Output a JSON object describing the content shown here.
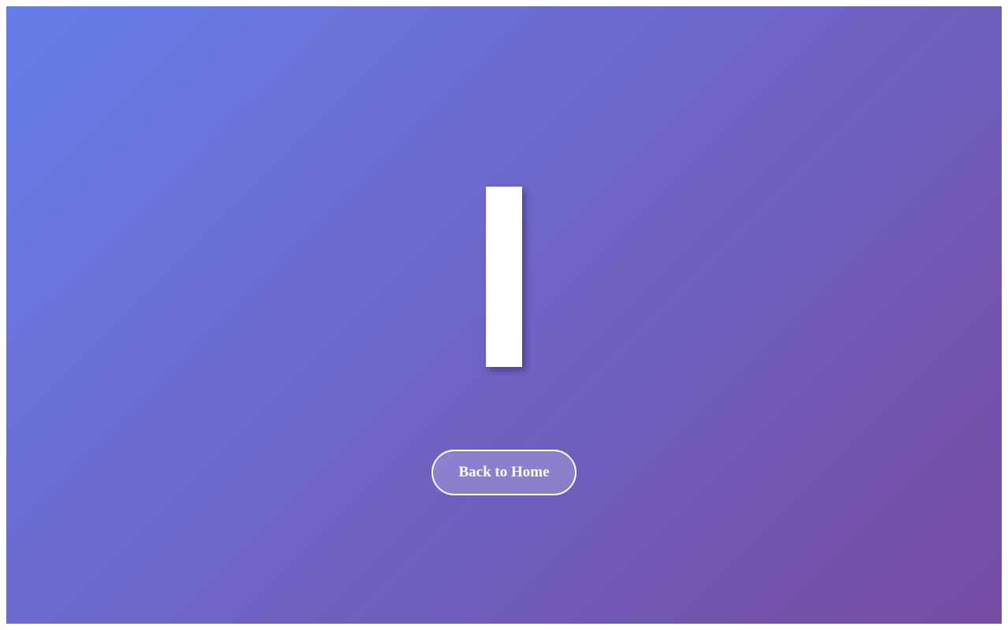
{
  "page": {
    "background_gradient": [
      "#667eea",
      "#764ba2"
    ]
  },
  "hero": {
    "glyph_color": "#ffffff"
  },
  "actions": {
    "back_to_home_label": "Back to Home"
  }
}
